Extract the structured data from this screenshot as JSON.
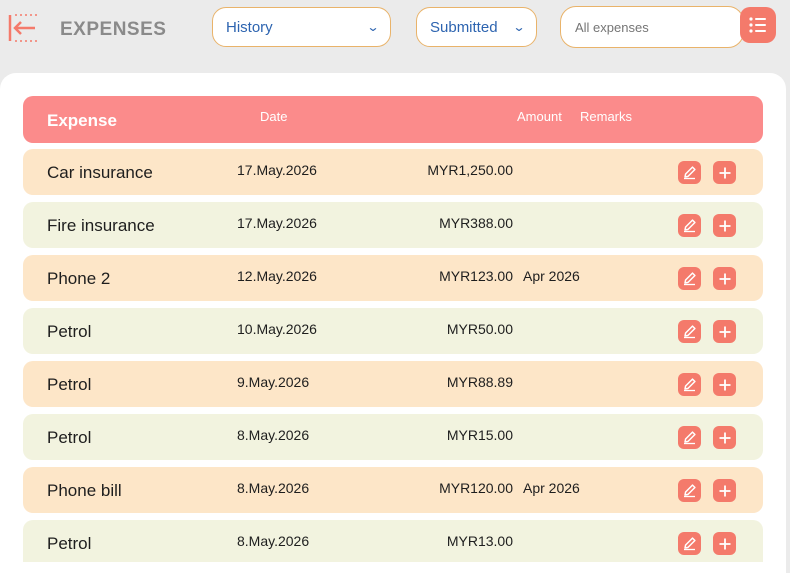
{
  "header": {
    "title": "EXPENSES",
    "history_select": "History",
    "status_select": "Submitted",
    "search_placeholder": "All expenses"
  },
  "colors": {
    "accent": "#f47a6b",
    "header_row": "#fb8b8b",
    "row_odd": "#fde6c8",
    "row_even": "#f2f3df",
    "control_text": "#2d64b0",
    "control_border": "#e9b36a"
  },
  "icons": {
    "back": "back-arrow-icon",
    "menu": "list-menu-icon",
    "edit": "pencil-icon",
    "add": "plus-icon"
  },
  "table": {
    "columns": {
      "expense": "Expense",
      "date": "Date",
      "amount": "Amount",
      "remarks": "Remarks"
    },
    "rows": [
      {
        "name": "Car insurance",
        "date": "17.May.2026",
        "amount": "MYR1,250.00",
        "remarks": ""
      },
      {
        "name": "Fire insurance",
        "date": "17.May.2026",
        "amount": "MYR388.00",
        "remarks": ""
      },
      {
        "name": "Phone 2",
        "date": "12.May.2026",
        "amount": "MYR123.00",
        "remarks": "Apr 2026"
      },
      {
        "name": "Petrol",
        "date": "10.May.2026",
        "amount": "MYR50.00",
        "remarks": ""
      },
      {
        "name": "Petrol",
        "date": "9.May.2026",
        "amount": "MYR88.89",
        "remarks": ""
      },
      {
        "name": "Petrol",
        "date": "8.May.2026",
        "amount": "MYR15.00",
        "remarks": ""
      },
      {
        "name": "Phone bill",
        "date": "8.May.2026",
        "amount": "MYR120.00",
        "remarks": "Apr 2026"
      },
      {
        "name": "Petrol",
        "date": "8.May.2026",
        "amount": "MYR13.00",
        "remarks": ""
      }
    ]
  }
}
